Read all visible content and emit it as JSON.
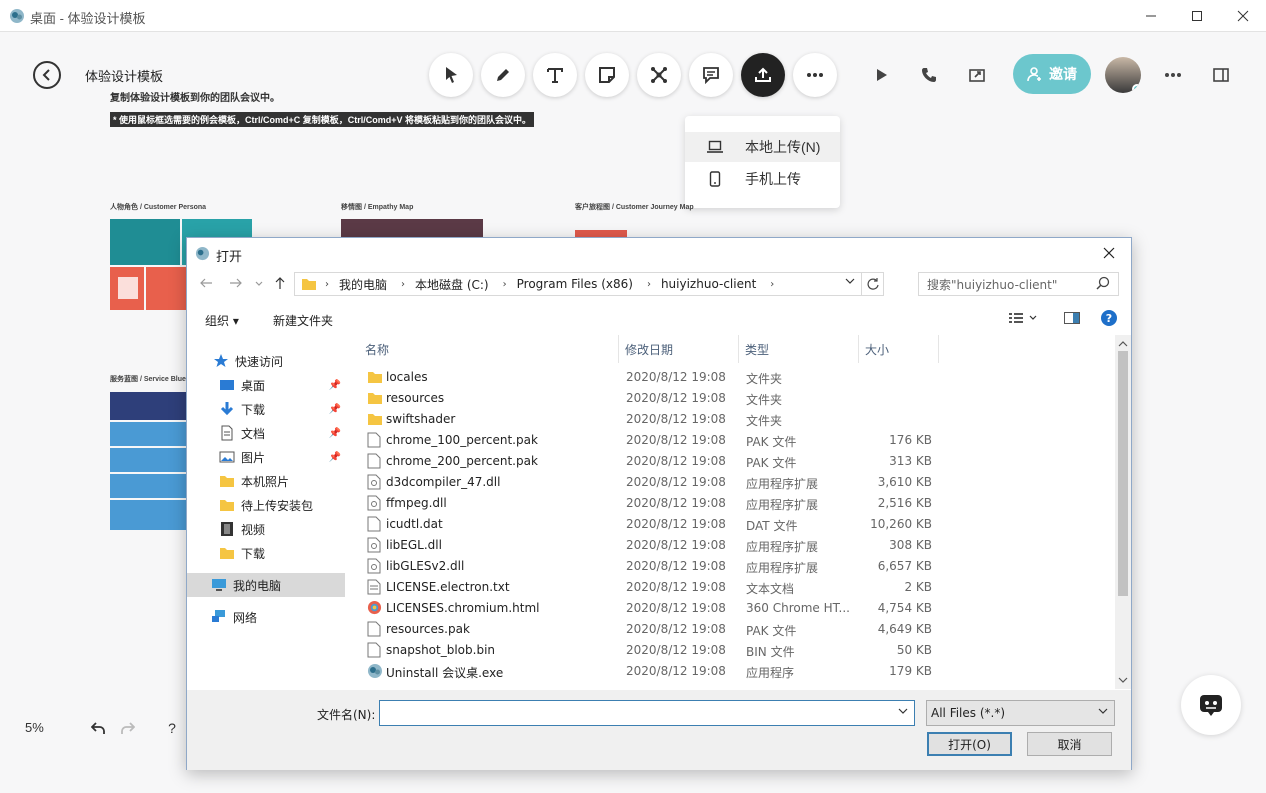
{
  "window": {
    "title": "桌面 - 体验设计模板"
  },
  "board": {
    "title": "体验设计模板",
    "subtitle": "复制体验设计模板到你的团队会议中。",
    "hint": "* 使用鼠标框选需要的例会模板，Ctrl/Comd+C 复制模板，Ctrl/Comd+V 将模板粘贴到你的团队会议中。",
    "templates": [
      {
        "label": "人物角色 / Customer Persona"
      },
      {
        "label": "移情图 / Empathy Map"
      },
      {
        "label": "客户旅程图 / Customer Journey Map"
      },
      {
        "label": "服务蓝图 / Service Blue"
      }
    ]
  },
  "toolbar": {
    "tools": [
      "select-icon",
      "pen-icon",
      "text-icon",
      "sticky-note-icon",
      "shape-icon",
      "comment-icon",
      "upload-icon",
      "more-icon"
    ],
    "invite_label": "邀请"
  },
  "upload_menu": {
    "items": [
      {
        "label": "本地上传(N)"
      },
      {
        "label": "手机上传"
      }
    ]
  },
  "status": {
    "zoom": "5%",
    "help": "?"
  },
  "dialog": {
    "title": "打开",
    "breadcrumb": [
      "我的电脑",
      "本地磁盘 (C:)",
      "Program Files (x86)",
      "huiyizhuo-client"
    ],
    "search_placeholder": "搜索\"huiyizhuo-client\"",
    "organize_label": "组织 ▾",
    "new_folder_label": "新建文件夹",
    "nav": {
      "quick_access": "快速访问",
      "items": [
        {
          "label": "桌面",
          "pinned": true
        },
        {
          "label": "下载",
          "pinned": true
        },
        {
          "label": "文档",
          "pinned": true
        },
        {
          "label": "图片",
          "pinned": true
        },
        {
          "label": "本机照片",
          "pinned": false
        },
        {
          "label": "待上传安装包",
          "pinned": false
        },
        {
          "label": "视频",
          "pinned": false
        },
        {
          "label": "下载",
          "pinned": false
        }
      ],
      "this_pc": "我的电脑",
      "network": "网络"
    },
    "columns": {
      "name": "名称",
      "date": "修改日期",
      "type": "类型",
      "size": "大小"
    },
    "files": [
      {
        "name": "locales",
        "date": "2020/8/12 19:08",
        "type": "文件夹",
        "size": "",
        "kind": "folder"
      },
      {
        "name": "resources",
        "date": "2020/8/12 19:08",
        "type": "文件夹",
        "size": "",
        "kind": "folder"
      },
      {
        "name": "swiftshader",
        "date": "2020/8/12 19:08",
        "type": "文件夹",
        "size": "",
        "kind": "folder"
      },
      {
        "name": "chrome_100_percent.pak",
        "date": "2020/8/12 19:08",
        "type": "PAK 文件",
        "size": "176 KB",
        "kind": "file"
      },
      {
        "name": "chrome_200_percent.pak",
        "date": "2020/8/12 19:08",
        "type": "PAK 文件",
        "size": "313 KB",
        "kind": "file"
      },
      {
        "name": "d3dcompiler_47.dll",
        "date": "2020/8/12 19:08",
        "type": "应用程序扩展",
        "size": "3,610 KB",
        "kind": "dll"
      },
      {
        "name": "ffmpeg.dll",
        "date": "2020/8/12 19:08",
        "type": "应用程序扩展",
        "size": "2,516 KB",
        "kind": "dll"
      },
      {
        "name": "icudtl.dat",
        "date": "2020/8/12 19:08",
        "type": "DAT 文件",
        "size": "10,260 KB",
        "kind": "file"
      },
      {
        "name": "libEGL.dll",
        "date": "2020/8/12 19:08",
        "type": "应用程序扩展",
        "size": "308 KB",
        "kind": "dll"
      },
      {
        "name": "libGLESv2.dll",
        "date": "2020/8/12 19:08",
        "type": "应用程序扩展",
        "size": "6,657 KB",
        "kind": "dll"
      },
      {
        "name": "LICENSE.electron.txt",
        "date": "2020/8/12 19:08",
        "type": "文本文档",
        "size": "2 KB",
        "kind": "txt"
      },
      {
        "name": "LICENSES.chromium.html",
        "date": "2020/8/12 19:08",
        "type": "360 Chrome HT...",
        "size": "4,754 KB",
        "kind": "html"
      },
      {
        "name": "resources.pak",
        "date": "2020/8/12 19:08",
        "type": "PAK 文件",
        "size": "4,649 KB",
        "kind": "file"
      },
      {
        "name": "snapshot_blob.bin",
        "date": "2020/8/12 19:08",
        "type": "BIN 文件",
        "size": "50 KB",
        "kind": "file"
      },
      {
        "name": "Uninstall 会议桌.exe",
        "date": "2020/8/12 19:08",
        "type": "应用程序",
        "size": "179 KB",
        "kind": "exe"
      }
    ],
    "filename_label": "文件名(N):",
    "filename_value": "",
    "filter": "All Files (*.*)",
    "open_label": "打开(O)",
    "cancel_label": "取消"
  },
  "colors": {
    "accent": "#6cc7cd",
    "persona_teal": "#1f8d94",
    "persona_red": "#e8604c",
    "empathy_dark": "#5b3a46",
    "journey_red": "#e05a4c",
    "blueprint_navy": "#2e3f7a",
    "blueprint_blue": "#4a9ad4"
  }
}
